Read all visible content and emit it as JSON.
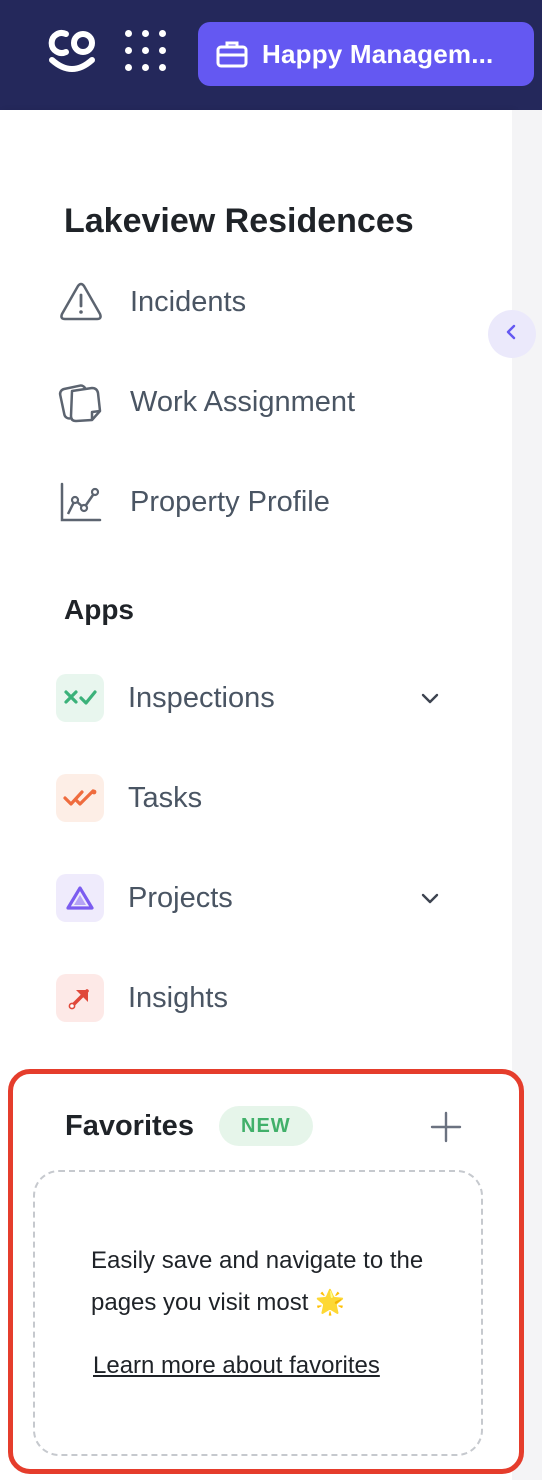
{
  "topbar": {
    "logo_icon": "co-smile-logo-icon",
    "apps_icon": "apps-grid-icon",
    "org_switcher": {
      "icon": "briefcase-icon",
      "label": "Happy Managem..."
    }
  },
  "sidebar": {
    "collapse_icon": "chevron-left-icon",
    "property_title": "Lakeview Residences",
    "nav": [
      {
        "label": "Incidents",
        "icon": "alert-triangle-icon"
      },
      {
        "label": "Work Assignment",
        "icon": "stacked-pages-icon"
      },
      {
        "label": "Property Profile",
        "icon": "line-chart-icon"
      }
    ],
    "apps_heading": "Apps",
    "apps": [
      {
        "label": "Inspections",
        "icon": "check-x-icon",
        "has_submenu": true,
        "color": "#3bb27a",
        "bg": "#e8f6ee"
      },
      {
        "label": "Tasks",
        "icon": "double-check-icon",
        "has_submenu": false,
        "color": "#ef6c3e",
        "bg": "#fdeee6"
      },
      {
        "label": "Projects",
        "icon": "triangle-nodes-icon",
        "has_submenu": true,
        "color": "#7b5cf0",
        "bg": "#efebfc"
      },
      {
        "label": "Insights",
        "icon": "arrow-up-right-icon",
        "has_submenu": false,
        "color": "#e0483a",
        "bg": "#fde9e7"
      }
    ]
  },
  "favorites": {
    "title": "Favorites",
    "badge": "NEW",
    "add_icon": "plus-icon",
    "empty_message": "Easily save and navigate to the pages you visit most 🌟",
    "learn_more": "Learn more about favorites"
  },
  "colors": {
    "topbar_bg": "#24285b",
    "accent": "#6458f2",
    "highlight_border": "#e53d2c"
  }
}
